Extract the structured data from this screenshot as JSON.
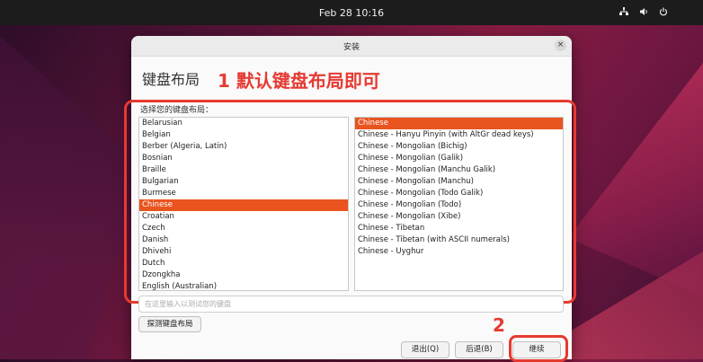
{
  "topbar": {
    "clock": "Feb 28  10:16",
    "icons": [
      "network-icon",
      "volume-icon",
      "power-icon"
    ]
  },
  "dialog": {
    "title": "安装",
    "close_icon": "×",
    "heading": "键盘布局",
    "annotation_1": "1 默认键盘布局即可",
    "annotation_2": "2",
    "prompt_label": "选择您的键盘布局：",
    "layouts": [
      "Belarusian",
      "Belgian",
      "Berber (Algeria, Latin)",
      "Bosnian",
      "Braille",
      "Bulgarian",
      "Burmese",
      "Chinese",
      "Croatian",
      "Czech",
      "Danish",
      "Dhivehi",
      "Dutch",
      "Dzongkha",
      "English (Australian)"
    ],
    "selected_layout": "Chinese",
    "variants": [
      "Chinese",
      "Chinese - Hanyu Pinyin (with AltGr dead keys)",
      "Chinese - Mongolian (Bichig)",
      "Chinese - Mongolian (Galik)",
      "Chinese - Mongolian (Manchu Galik)",
      "Chinese - Mongolian (Manchu)",
      "Chinese - Mongolian (Todo Galik)",
      "Chinese - Mongolian (Todo)",
      "Chinese - Mongolian (Xibe)",
      "Chinese - Tibetan",
      "Chinese - Tibetan (with ASCII numerals)",
      "Chinese - Uyghur"
    ],
    "selected_variant": "Chinese",
    "test_placeholder": "在这里输入以测试您的键盘",
    "detect_label": "探测键盘布局",
    "quit_label": "退出(Q)",
    "back_label": "后退(B)",
    "next_label": "继续"
  }
}
